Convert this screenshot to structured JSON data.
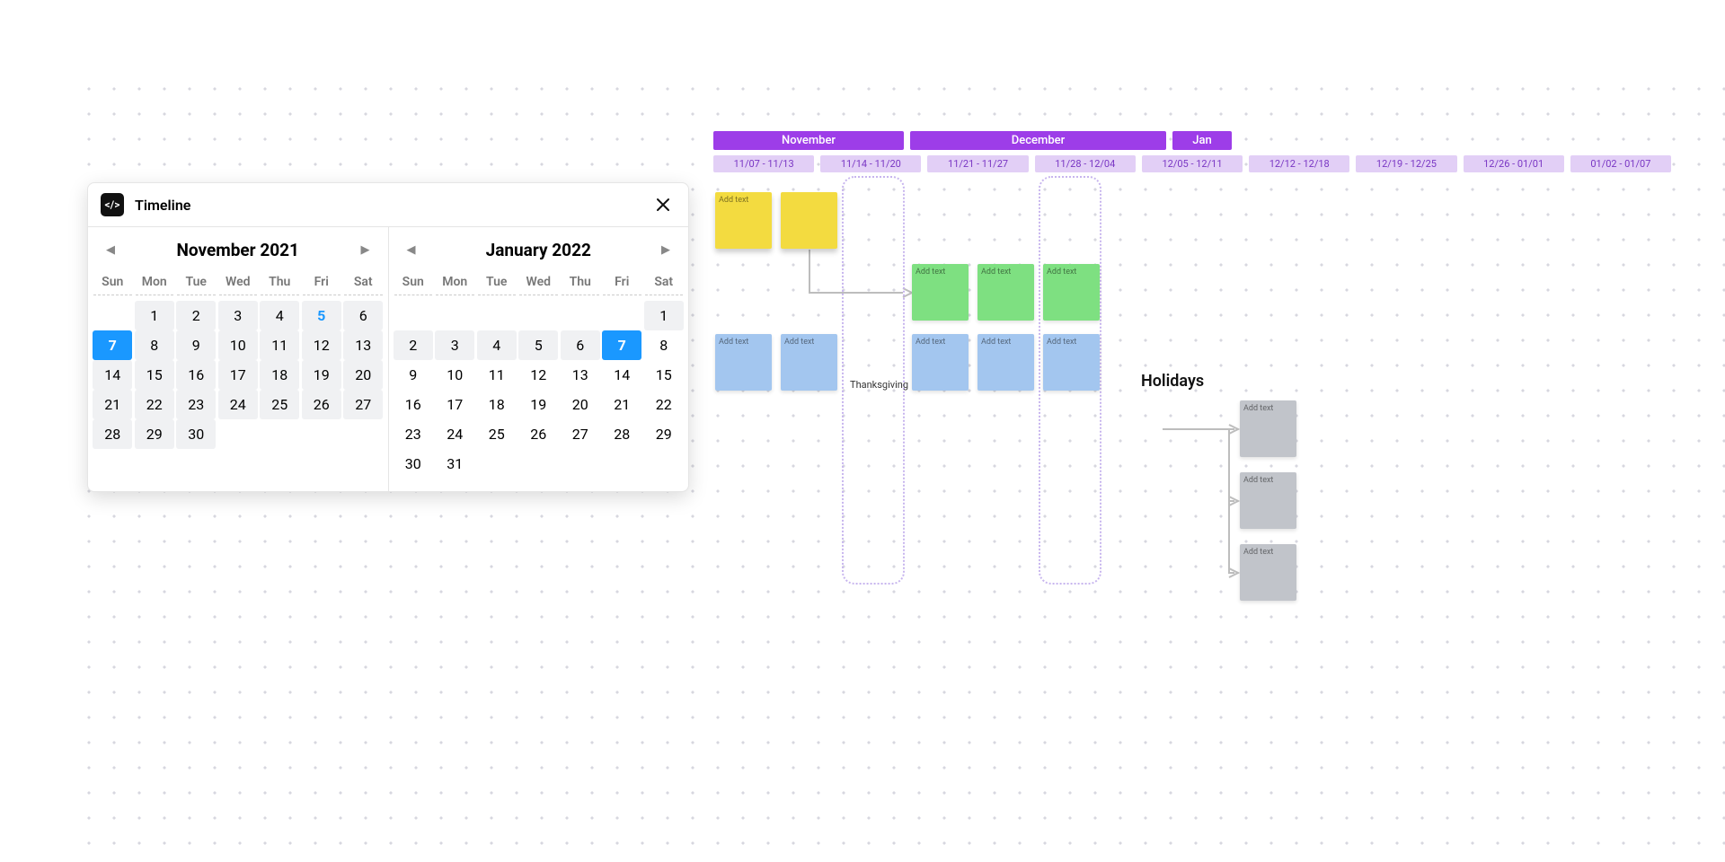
{
  "dialog": {
    "title": "Timeline",
    "icon_label": "</>",
    "months": [
      {
        "title": "November  2021",
        "dow": [
          "Sun",
          "Mon",
          "Tue",
          "Wed",
          "Thu",
          "Fri",
          "Sat"
        ],
        "first_weekday": 1,
        "days": 30,
        "selected": 7,
        "today": 5,
        "range_start": 1,
        "range_end": 30
      },
      {
        "title": "January  2022",
        "dow": [
          "Sun",
          "Mon",
          "Tue",
          "Wed",
          "Thu",
          "Fri",
          "Sat"
        ],
        "first_weekday": 6,
        "days": 31,
        "selected": 7,
        "today": null,
        "range_start": 1,
        "range_end": 7
      }
    ]
  },
  "board": {
    "months": [
      {
        "label": "November",
        "span": 3
      },
      {
        "label": "December",
        "span": 4
      },
      {
        "label": "Jan",
        "span": 1
      }
    ],
    "weeks": [
      "11/07 - 11/13",
      "11/14 - 11/20",
      "11/21 - 11/27",
      "11/28 - 12/04",
      "12/05 - 12/11",
      "12/12 - 12/18",
      "12/19 - 12/25",
      "12/26 - 01/01",
      "01/02 - 01/07"
    ],
    "ghost_cols": [
      2,
      5
    ],
    "labels": {
      "thanksgiving": "Thanksgiving",
      "holidays": "Holidays"
    },
    "sticky_placeholder": "Add text",
    "stickies": [
      {
        "color": "yellow",
        "col": 0,
        "row": 0,
        "text": true
      },
      {
        "color": "yellow",
        "col": 1,
        "row": 0,
        "text": false
      },
      {
        "color": "green",
        "col": 3,
        "row": 1,
        "text": true
      },
      {
        "color": "green",
        "col": 4,
        "row": 1,
        "text": true
      },
      {
        "color": "green",
        "col": 5,
        "row": 1,
        "text": true
      },
      {
        "color": "blue",
        "col": 0,
        "row": 2,
        "text": true
      },
      {
        "color": "blue",
        "col": 1,
        "row": 2,
        "text": true
      },
      {
        "color": "blue",
        "col": 3,
        "row": 2,
        "text": true
      },
      {
        "color": "blue",
        "col": 4,
        "row": 2,
        "text": true
      },
      {
        "color": "blue",
        "col": 5,
        "row": 2,
        "text": true
      },
      {
        "color": "gray",
        "col": 8,
        "row": 3,
        "text": true
      },
      {
        "color": "gray",
        "col": 8,
        "row": 4,
        "text": true
      },
      {
        "color": "gray",
        "col": 8,
        "row": 5,
        "text": true
      }
    ]
  }
}
